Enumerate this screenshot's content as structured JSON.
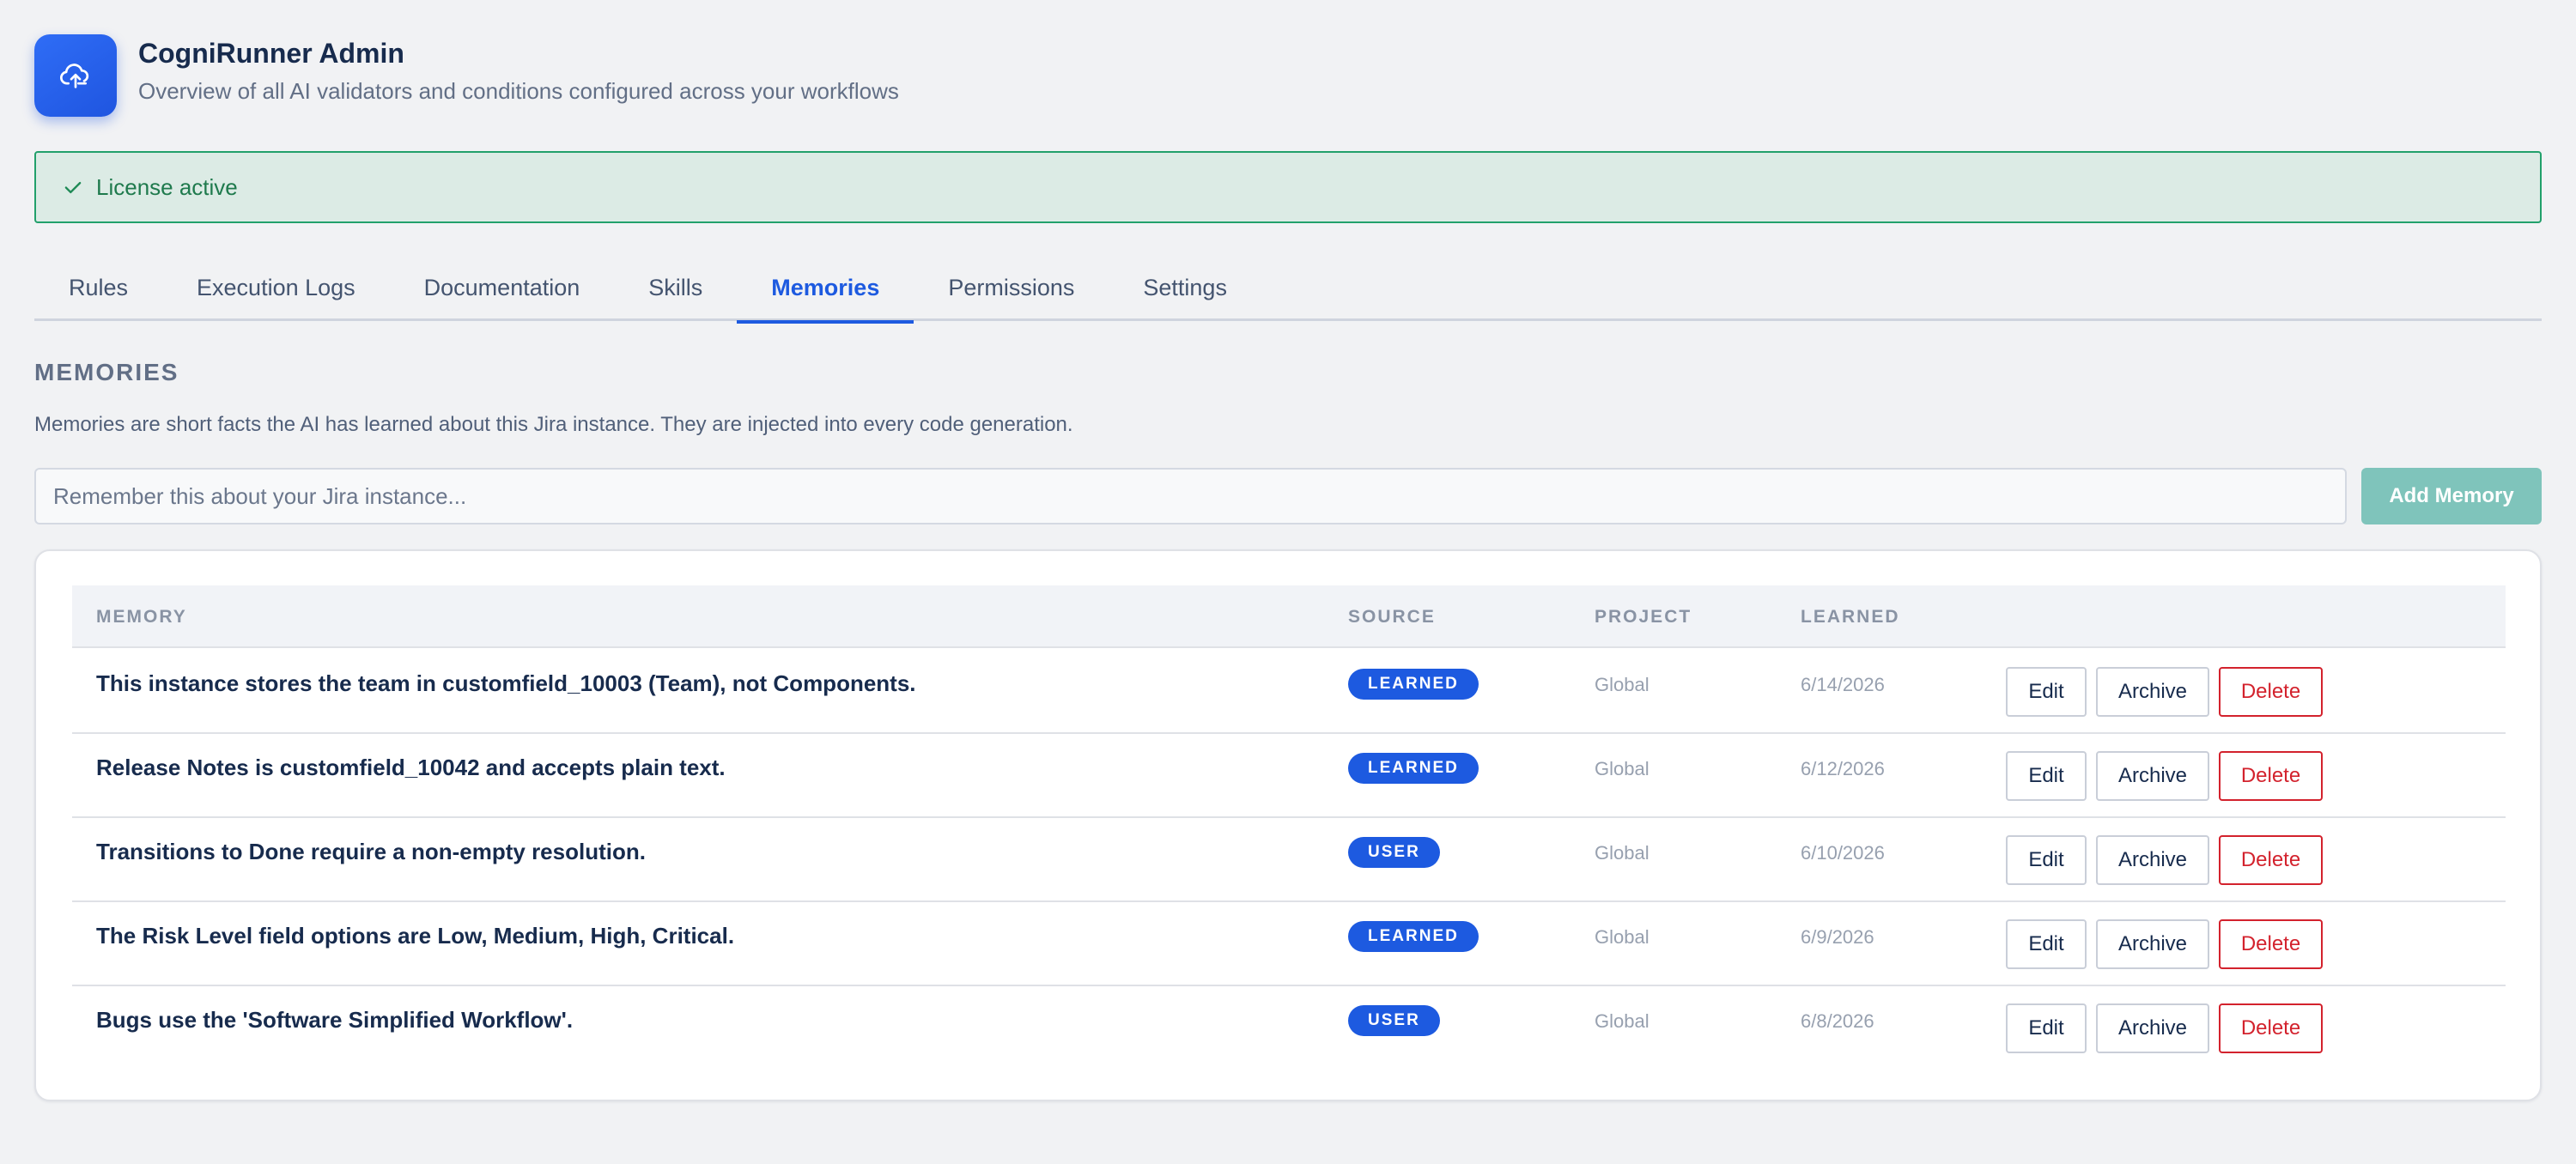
{
  "header": {
    "title": "CogniRunner Admin",
    "subtitle": "Overview of all AI validators and conditions configured across your workflows",
    "logo_icon": "cloud-upload-icon"
  },
  "license": {
    "text": "License active",
    "icon": "check-icon",
    "color": "#22a06b"
  },
  "tabs": [
    {
      "label": "Rules"
    },
    {
      "label": "Execution Logs"
    },
    {
      "label": "Documentation"
    },
    {
      "label": "Skills"
    },
    {
      "label": "Memories",
      "active": true
    },
    {
      "label": "Permissions"
    },
    {
      "label": "Settings"
    }
  ],
  "section": {
    "title": "MEMORIES",
    "description": "Memories are short facts the AI has learned about this Jira instance. They are injected into every code generation."
  },
  "memory_input": {
    "value": "",
    "placeholder": "Remember this about your Jira instance..."
  },
  "add_button": {
    "label": "Add Memory",
    "color": "#7fc4bb"
  },
  "table": {
    "columns": [
      "MEMORY",
      "SOURCE",
      "PROJECT",
      "LEARNED",
      ""
    ],
    "rows": [
      {
        "memory": "This instance stores the team in customfield_10003 (Team), not Components.",
        "source": "LEARNED",
        "project": "Global",
        "learned": "6/14/2026"
      },
      {
        "memory": "Release Notes is customfield_10042 and accepts plain text.",
        "source": "LEARNED",
        "project": "Global",
        "learned": "6/12/2026"
      },
      {
        "memory": "Transitions to Done require a non-empty resolution.",
        "source": "USER",
        "project": "Global",
        "learned": "6/10/2026"
      },
      {
        "memory": "The Risk Level field options are Low, Medium, High, Critical.",
        "source": "LEARNED",
        "project": "Global",
        "learned": "6/9/2026"
      },
      {
        "memory": "Bugs use the 'Software Simplified Workflow'.",
        "source": "USER",
        "project": "Global",
        "learned": "6/8/2026"
      }
    ],
    "actions": {
      "edit": "Edit",
      "archive": "Archive",
      "delete": "Delete"
    }
  },
  "colors": {
    "accent": "#1d5ae0",
    "badge": "#1d5ae0",
    "danger": "#d3222d",
    "background": "#f1f2f4"
  }
}
